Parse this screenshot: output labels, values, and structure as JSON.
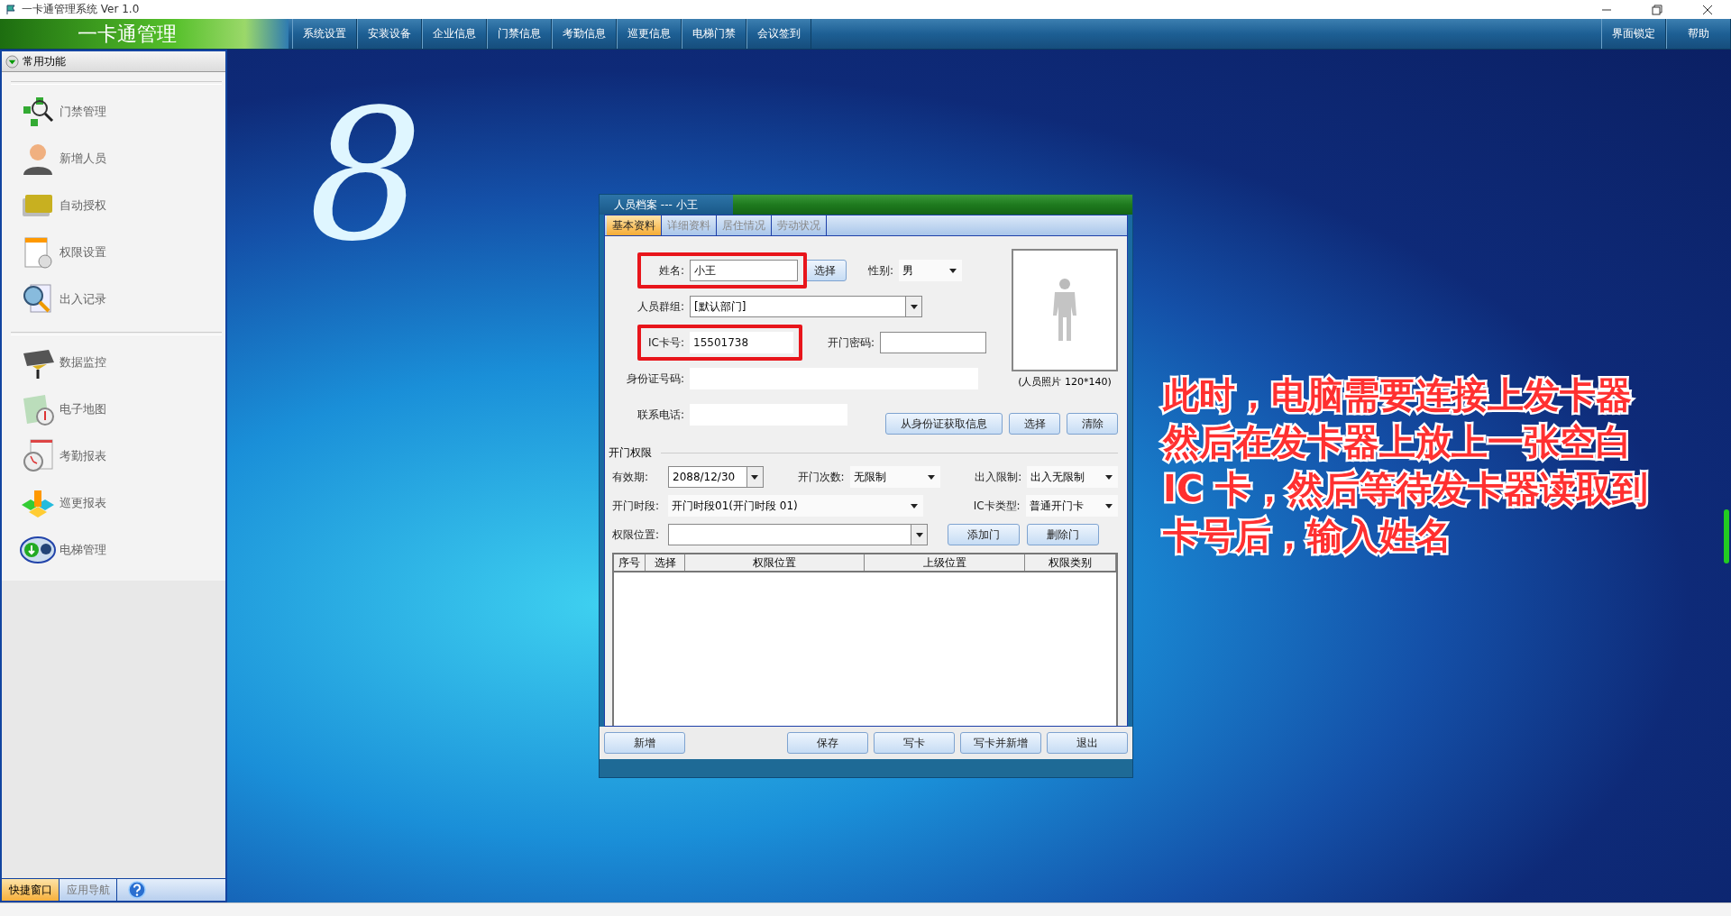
{
  "window": {
    "title": "一卡通管理系统 Ver 1.0"
  },
  "brand": "一卡通管理",
  "menu": [
    {
      "label": "系统设置"
    },
    {
      "label": "安装设备"
    },
    {
      "label": "企业信息"
    },
    {
      "label": "门禁信息"
    },
    {
      "label": "考勤信息"
    },
    {
      "label": "巡更信息"
    },
    {
      "label": "电梯门禁"
    },
    {
      "label": "会议签到"
    }
  ],
  "menu_right": [
    {
      "label": "界面锁定"
    },
    {
      "label": "帮助"
    }
  ],
  "sidebar": {
    "header": "常用功能",
    "groups": [
      [
        {
          "label": "门禁管理"
        },
        {
          "label": "新增人员"
        },
        {
          "label": "自动授权"
        },
        {
          "label": "权限设置"
        },
        {
          "label": "出入记录"
        }
      ],
      [
        {
          "label": "数据监控"
        },
        {
          "label": "电子地图"
        },
        {
          "label": "考勤报表"
        },
        {
          "label": "巡更报表"
        },
        {
          "label": "电梯管理"
        }
      ]
    ],
    "tabs": [
      {
        "label": "快捷窗口",
        "selected": true
      },
      {
        "label": "应用导航",
        "selected": false
      }
    ]
  },
  "wallpaper_logo": "8",
  "dialog": {
    "title": "人员档案 --- 小王",
    "tabs": [
      {
        "label": "基本资料",
        "selected": true
      },
      {
        "label": "详细资料",
        "selected": false
      },
      {
        "label": "居住情况",
        "selected": false
      },
      {
        "label": "劳动状况",
        "selected": false
      }
    ],
    "name": {
      "label": "姓名:",
      "value": "小王",
      "highlighted": true
    },
    "name_button": "选择",
    "gender": {
      "label": "性别:",
      "value": "男"
    },
    "group": {
      "label": "人员群组:",
      "value": "[默认部门]"
    },
    "card": {
      "label": "IC卡号:",
      "value": "15501738",
      "highlighted": true
    },
    "password": {
      "label": "开门密码:"
    },
    "id_number": {
      "label": "身份证号码:"
    },
    "phone": {
      "label": "联系电话:"
    },
    "photo_caption": "(人员照片 120*140)",
    "photo_buttons": [
      "从身份证获取信息",
      "选择",
      "清除"
    ],
    "section": "开门权限",
    "expiry": {
      "label": "有效期:",
      "value": "2088/12/30"
    },
    "open_count": {
      "label": "开门次数:",
      "value": "无限制"
    },
    "access_limit": {
      "label": "出入限制:",
      "value": "出入无限制"
    },
    "time_slot": {
      "label": "开门时段:",
      "value": "开门时段01(开门时段 01)"
    },
    "card_type": {
      "label": "IC卡类型:",
      "value": "普通开门卡"
    },
    "location": {
      "label": "权限位置:"
    },
    "door_buttons": [
      "添加门",
      "删除门"
    ],
    "table": {
      "columns": [
        "序号",
        "选择",
        "权限位置",
        "上级位置",
        "权限类别"
      ]
    },
    "footer_left": "新增",
    "footer_buttons": [
      "保存",
      "写卡",
      "写卡并新增",
      "退出"
    ]
  },
  "annotation": [
    "此时，电脑需要连接上发卡器",
    "然后在发卡器上放上一张空白",
    "IC 卡，然后等待发卡器读取到",
    "卡号后，输入姓名"
  ]
}
